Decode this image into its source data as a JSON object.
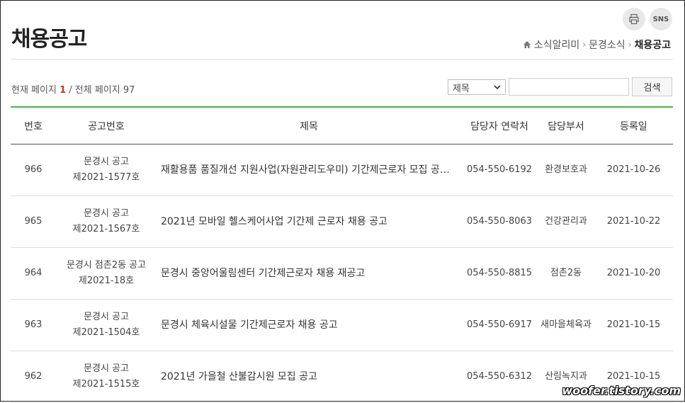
{
  "page": {
    "title": "채용공고"
  },
  "top_buttons": {
    "sns_label": "SNS",
    "print_icon": "print-icon"
  },
  "breadcrumb": {
    "items": [
      "소식알리미",
      "문경소식"
    ],
    "current": "채용공고"
  },
  "paging": {
    "current_label": "현재 페이지",
    "current": "1",
    "total_label": "/ 전체 페이지",
    "total": "97"
  },
  "search": {
    "select_value": "제목",
    "button_label": "검색"
  },
  "table": {
    "headers": [
      "번호",
      "공고번호",
      "제목",
      "담당자 연락처",
      "담당부서",
      "등록일"
    ],
    "rows": [
      {
        "no": "966",
        "notice_line1": "문경시 공고",
        "notice_line2": "제2021-1577호",
        "subject": "재활용품 품질개선 지원사업(자원관리도우미) 기간제근로자 모집 공고(수정)",
        "phone": "054-550-6192",
        "dept": "환경보호과",
        "date": "2021-10-26"
      },
      {
        "no": "965",
        "notice_line1": "문경시 공고",
        "notice_line2": "제2021-1567호",
        "subject": "2021년 모바일 헬스케어사업 기간제 근로자 채용 공고",
        "phone": "054-550-8063",
        "dept": "건강관리과",
        "date": "2021-10-22"
      },
      {
        "no": "964",
        "notice_line1": "문경시 점촌2동 공고",
        "notice_line2": "제2021-18호",
        "subject": "문경시 중앙어울림센터 기간제근로자 채용 재공고",
        "phone": "054-550-8815",
        "dept": "점촌2동",
        "date": "2021-10-20"
      },
      {
        "no": "963",
        "notice_line1": "문경시 공고",
        "notice_line2": "제2021-1504호",
        "subject": "문경시 체육시설물 기간제근로자 채용 공고",
        "phone": "054-550-6917",
        "dept": "새마을체육과",
        "date": "2021-10-15"
      },
      {
        "no": "962",
        "notice_line1": "문경시 공고",
        "notice_line2": "제2021-1515호",
        "subject": "2021년 가을철 산불감시원 모집 공고",
        "phone": "054-550-6312",
        "dept": "산림녹지과",
        "date": "2021-10-15"
      }
    ]
  },
  "watermark": "woofer.tistory.com"
}
